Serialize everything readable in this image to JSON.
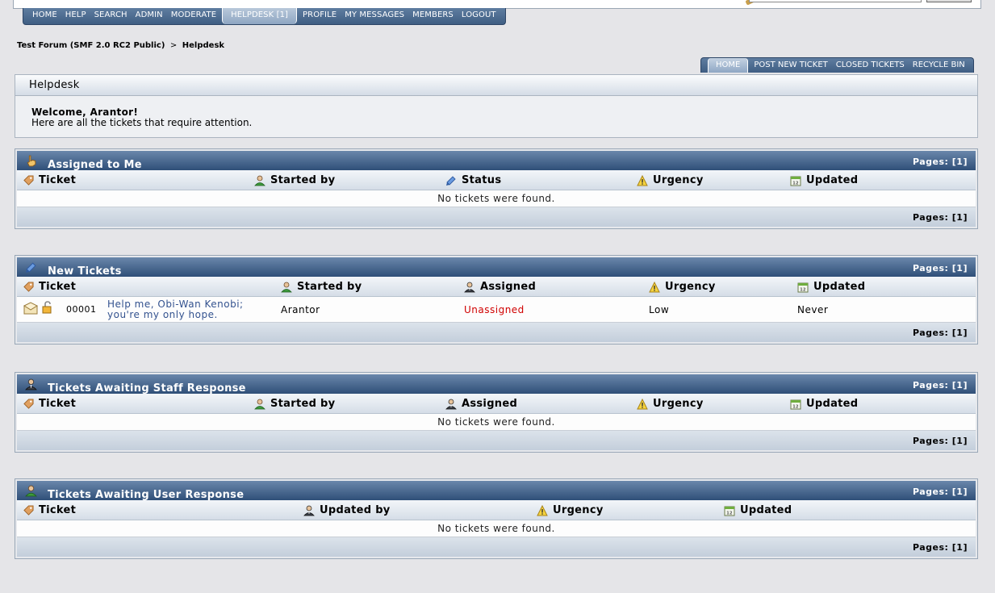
{
  "main_menu": [
    {
      "label": "HOME",
      "active": false
    },
    {
      "label": "HELP",
      "active": false
    },
    {
      "label": "SEARCH",
      "active": false
    },
    {
      "label": "ADMIN",
      "active": false
    },
    {
      "label": "MODERATE",
      "active": false
    },
    {
      "label": "HELPDESK [1]",
      "active": true
    },
    {
      "label": "PROFILE",
      "active": false
    },
    {
      "label": "MY MESSAGES",
      "active": false
    },
    {
      "label": "MEMBERS",
      "active": false
    },
    {
      "label": "LOGOUT",
      "active": false
    }
  ],
  "breadcrumb": {
    "forum": "Test Forum (SMF 2.0 RC2 Public)",
    "separator": ">",
    "current": "Helpdesk"
  },
  "helpdesk_menu": [
    {
      "label": "HOME",
      "active": true
    },
    {
      "label": "POST NEW TICKET",
      "active": false
    },
    {
      "label": "CLOSED TICKETS",
      "active": false
    },
    {
      "label": "RECYCLE BIN",
      "active": false
    }
  ],
  "helpdesk_box": {
    "title": "Helpdesk",
    "welcome": "Welcome, Arantor!",
    "subtitle": "Here are all the tickets that require attention."
  },
  "sections": {
    "assigned": {
      "title": "Assigned to Me",
      "icon": "hand-pointer-icon",
      "pages": "Pages: [1]",
      "columns": [
        "Ticket",
        "Started by",
        "Status",
        "Urgency",
        "Updated"
      ],
      "empty_message": "No tickets were found."
    },
    "new": {
      "title": "New Tickets",
      "icon": "ticket-tag-icon",
      "pages": "Pages: [1]",
      "columns": [
        "Ticket",
        "Started by",
        "Assigned",
        "Urgency",
        "Updated"
      ],
      "tickets": [
        {
          "id": "00001",
          "subject_line1": "Help me, Obi-Wan Kenobi;",
          "subject_line2": "you're my only hope.",
          "started_by": "Arantor",
          "assigned": "Unassigned",
          "urgency": "Low",
          "updated": "Never"
        }
      ]
    },
    "staff": {
      "title": "Tickets Awaiting Staff Response",
      "icon": "staff-user-icon",
      "pages": "Pages: [1]",
      "columns": [
        "Ticket",
        "Started by",
        "Assigned",
        "Urgency",
        "Updated"
      ],
      "empty_message": "No tickets were found."
    },
    "user": {
      "title": "Tickets Awaiting User Response",
      "icon": "user-icon",
      "pages": "Pages: [1]",
      "columns": [
        "Ticket",
        "Updated by",
        "Urgency",
        "Updated"
      ],
      "empty_message": "No tickets were found."
    }
  },
  "colors": {
    "header_blue": "#3f5e83",
    "link": "#33528f",
    "unassigned_red": "#d00000"
  }
}
